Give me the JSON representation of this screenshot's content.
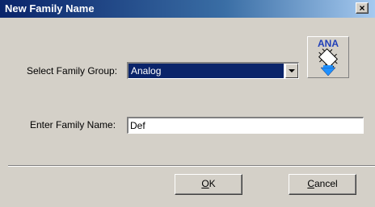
{
  "window": {
    "title": "New Family Name",
    "close_label": "×"
  },
  "form": {
    "group_label": "Select Family Group:",
    "group_value": "Analog",
    "name_label": "Enter Family Name:",
    "name_value": "Def"
  },
  "icon": {
    "name": "ana-family-icon",
    "text": "ANA",
    "color": "#1f3fb8",
    "arrow_color": "#1e90ff"
  },
  "buttons": {
    "ok_mnemonic": "O",
    "ok_rest": "K",
    "cancel_mnemonic": "C",
    "cancel_rest": "ancel"
  },
  "colors": {
    "title_bar": "#0a246a",
    "selection": "#0a246a",
    "face": "#d4d0c8"
  }
}
